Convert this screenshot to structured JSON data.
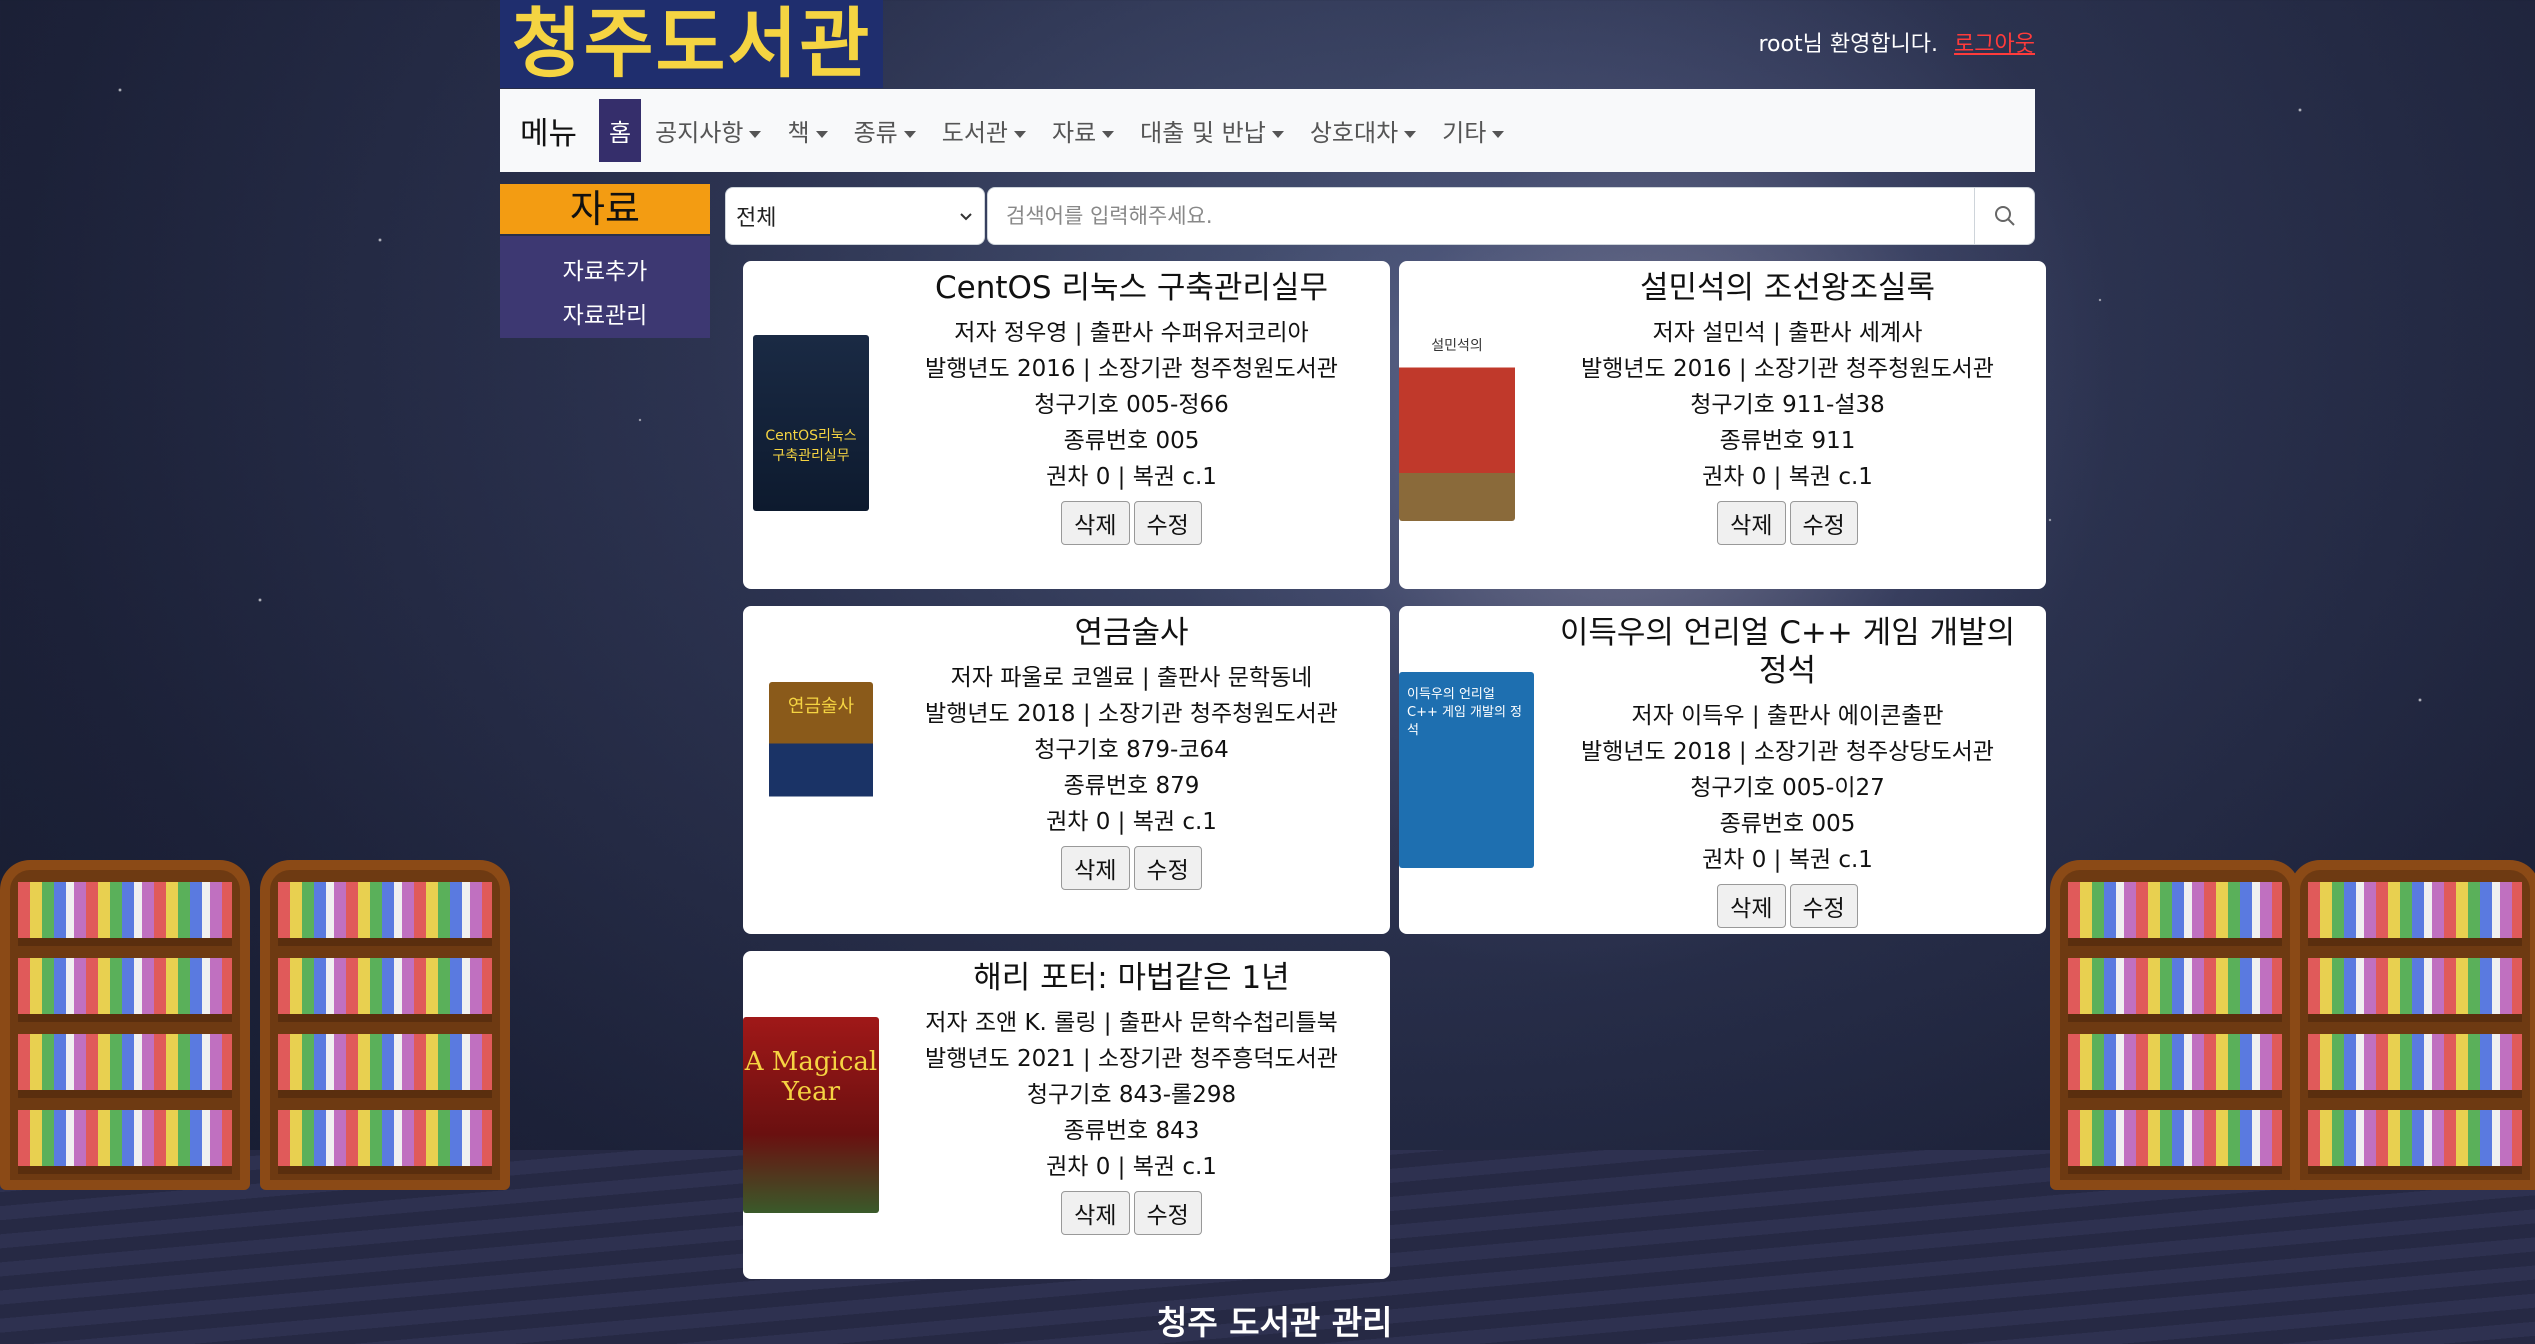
{
  "header": {
    "logo": "청주도서관",
    "welcome": "root님 환영합니다.",
    "logout": "로그아웃"
  },
  "nav": {
    "brand": "메뉴",
    "items": [
      "홈",
      "공지사항",
      "책",
      "종류",
      "도서관",
      "자료",
      "대출 및 반납",
      "상호대차",
      "기타"
    ]
  },
  "sidebar": {
    "title": "자료",
    "links": [
      "자료추가",
      "자료관리"
    ]
  },
  "search": {
    "select_value": "전체",
    "placeholder": "검색어를 입력해주세요."
  },
  "books": [
    {
      "title": "CentOS 리눅스 구축관리실무",
      "author_line": "저자 정우영 | 출판사 수퍼유저코리아",
      "year_line": "발행년도 2016 | 소장기관 청주청원도서관",
      "call_line": "청구기호 005-정66",
      "class_line": "종류번호 005",
      "vol_line": "권차 0 | 복권 c.1",
      "cover_text": "CentOS리눅스 구축관리실무"
    },
    {
      "title": "설민석의 조선왕조실록",
      "author_line": "저자 설민석 | 출판사 세계사",
      "year_line": "발행년도 2016 | 소장기관 청주청원도서관",
      "call_line": "청구기호 911-설38",
      "class_line": "종류번호 911",
      "vol_line": "권차 0 | 복권 c.1",
      "cover_text": "설민석의"
    },
    {
      "title": "연금술사",
      "author_line": "저자 파울로 코엘료 | 출판사 문학동네",
      "year_line": "발행년도 2018 | 소장기관 청주청원도서관",
      "call_line": "청구기호 879-코64",
      "class_line": "종류번호 879",
      "vol_line": "권차 0 | 복권 c.1",
      "cover_text": "연금술사"
    },
    {
      "title": "이득우의 언리얼 C++ 게임 개발의 정석",
      "author_line": "저자 이득우 | 출판사 에이콘출판",
      "year_line": "발행년도 2018 | 소장기관 청주상당도서관",
      "call_line": "청구기호 005-이27",
      "class_line": "종류번호 005",
      "vol_line": "권차 0 | 복권 c.1",
      "cover_text": "이득우의 언리얼 C++ 게임 개발의 정석"
    },
    {
      "title": "해리 포터: 마법같은 1년",
      "author_line": "저자 조앤 K. 롤링 | 출판사 문학수첩리틀북",
      "year_line": "발행년도 2021 | 소장기관 청주흥덕도서관",
      "call_line": "청구기호 843-롤298",
      "class_line": "종류번호 843",
      "vol_line": "권차 0 | 복권 c.1",
      "cover_text": "A Magical Year"
    }
  ],
  "buttons": {
    "delete": "삭제",
    "edit": "수정"
  },
  "footer": "청주 도서관 관리"
}
